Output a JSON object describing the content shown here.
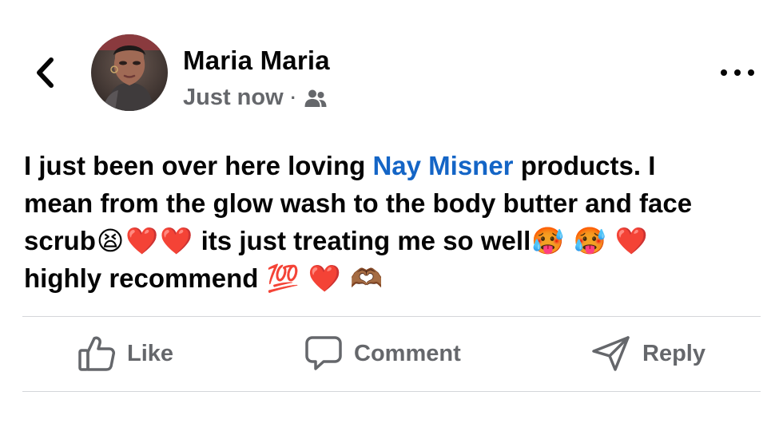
{
  "header": {
    "back_icon": "chevron-left-icon",
    "author_name": "Maria Maria",
    "timestamp": "Just now",
    "separator": "·",
    "audience_icon": "friends-icon",
    "more_icon": "more-horizontal-icon"
  },
  "post": {
    "line1_before": "I just been over here loving ",
    "mention": "Nay Misner",
    "line1_after": " products. I",
    "line2": "mean from the glow wash to the body butter and face",
    "line3_start": "scrub",
    "emoji_tired": "😫",
    "emoji_heart": "❤️",
    "line3_middle": " its just treating me so well",
    "emoji_hot": "🥵",
    "line4_start": "highly recommend ",
    "emoji_hundred": "💯",
    "emoji_heart_hands": "🫶🏾"
  },
  "actions": {
    "like_label": "Like",
    "comment_label": "Comment",
    "reply_label": "Reply"
  },
  "colors": {
    "text": "#050505",
    "secondary": "#65676b",
    "mention": "#1465c6",
    "divider": "#d4d6da"
  }
}
